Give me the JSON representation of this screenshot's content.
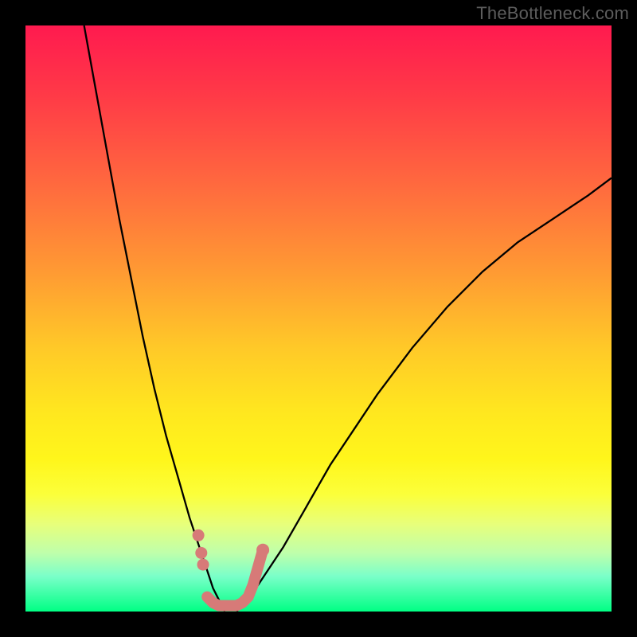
{
  "watermark": "TheBottleneck.com",
  "colors": {
    "frame": "#000000",
    "gradient_top": "#ff1a4f",
    "gradient_bottom": "#00ff84",
    "curve": "#000000",
    "marker": "#d77a78"
  },
  "chart_data": {
    "type": "line",
    "title": "",
    "xlabel": "",
    "ylabel": "",
    "xlim": [
      0,
      100
    ],
    "ylim": [
      0,
      100
    ],
    "background": "rainbow-gradient (red top to green bottom) representing bottleneck severity",
    "series": [
      {
        "name": "left-curve",
        "description": "steep descending curve from top-left to valley",
        "x": [
          10,
          12,
          14,
          16,
          18,
          20,
          22,
          24,
          26,
          28,
          30,
          31,
          32,
          33,
          34
        ],
        "y": [
          100,
          89,
          78,
          67,
          57,
          47,
          38,
          30,
          23,
          16,
          10,
          7,
          4,
          2,
          0
        ]
      },
      {
        "name": "right-curve",
        "description": "rising curve from valley toward top-right, concave",
        "x": [
          36,
          38,
          40,
          44,
          48,
          52,
          56,
          60,
          66,
          72,
          78,
          84,
          90,
          96,
          100
        ],
        "y": [
          0,
          2,
          5,
          11,
          18,
          25,
          31,
          37,
          45,
          52,
          58,
          63,
          67,
          71,
          74
        ]
      },
      {
        "name": "markers",
        "description": "pink dot/worm markers near valley bottom",
        "points": [
          {
            "x": 29.5,
            "y": 13
          },
          {
            "x": 30.0,
            "y": 10
          },
          {
            "x": 30.3,
            "y": 8
          },
          {
            "x": 31.0,
            "y": 2.5
          },
          {
            "x": 32.0,
            "y": 1.5
          },
          {
            "x": 33.0,
            "y": 1.0
          },
          {
            "x": 34.5,
            "y": 1.0
          },
          {
            "x": 36.0,
            "y": 1.0
          },
          {
            "x": 37.0,
            "y": 1.5
          },
          {
            "x": 38.0,
            "y": 2.5
          },
          {
            "x": 38.8,
            "y": 4.5
          },
          {
            "x": 40.5,
            "y": 10.5
          }
        ]
      }
    ]
  }
}
